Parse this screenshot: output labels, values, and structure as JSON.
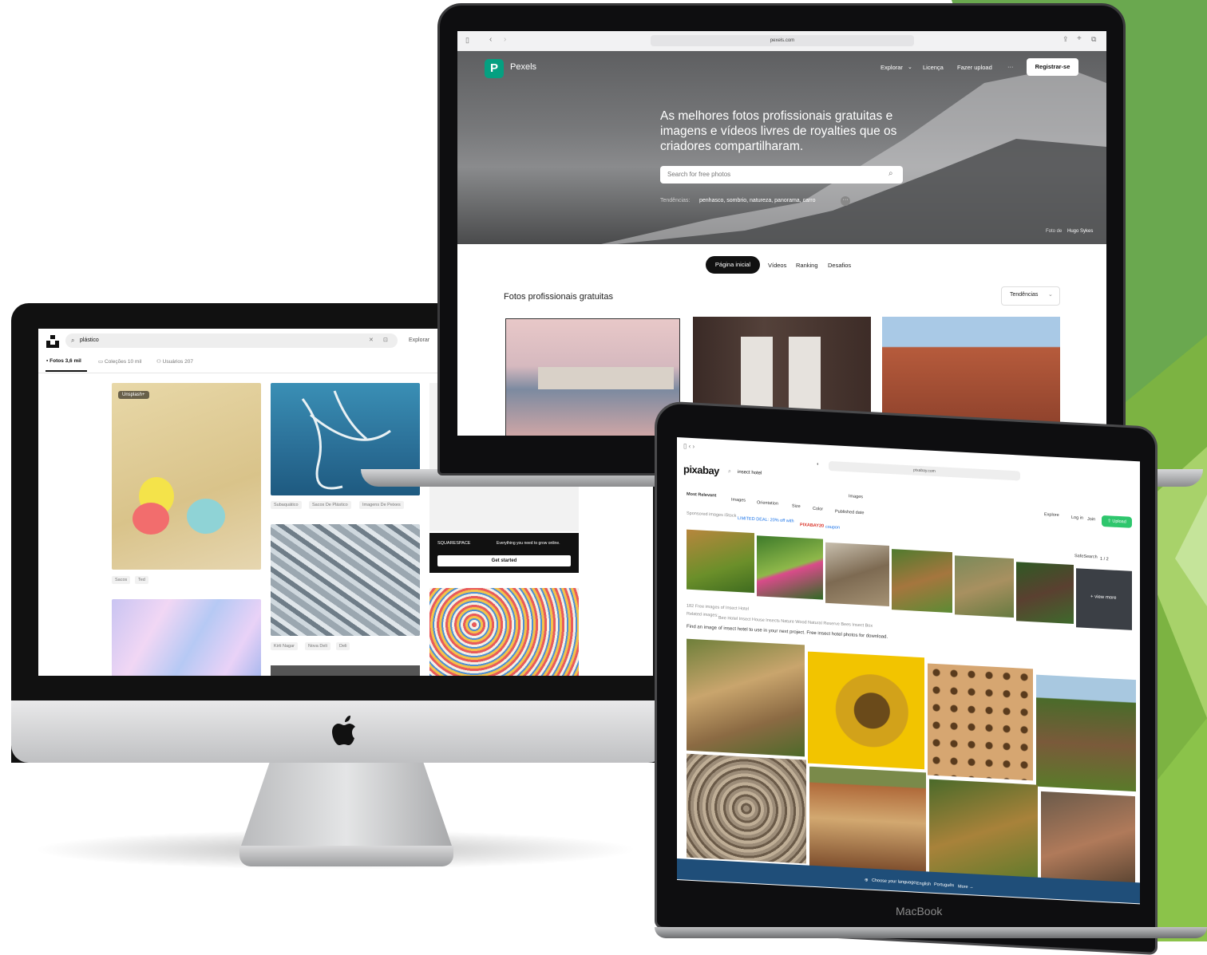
{
  "colors": {
    "green_accent": "#6aa84f",
    "green_light": "#8fc73e",
    "pexels_brand": "#05a081",
    "pixabay_green": "#2ec66d",
    "pixabay_footer": "#1f4e79"
  },
  "unsplash": {
    "search_value": "plástico",
    "explore": "Explorar",
    "tabs": [
      {
        "label": "Fotos 3,6 mil",
        "icon": "image-icon"
      },
      {
        "label": "Coleções 10 mil",
        "icon": "collection-icon"
      },
      {
        "label": "Usuários 207",
        "icon": "users-icon"
      }
    ],
    "badge": "Unsplash+",
    "tags_col1": [
      "Sacos",
      "Ted"
    ],
    "tags_col2a": [
      "Subaquático",
      "Sacos De Plástico",
      "Imagens De Peixes"
    ],
    "tags_col2b": [
      "Kirti Nagar",
      "Nova Deli",
      "Deli"
    ],
    "ad_brand": "SQUARESPACE",
    "ad_text": "Everything you need to grow online.",
    "ad_button": "Get started"
  },
  "pexels": {
    "url": "pexels.com",
    "brand": "Pexels",
    "nav": [
      "Explorar",
      "Licença",
      "Fazer upload",
      "···"
    ],
    "signup": "Registrar-se",
    "headline": "As melhores fotos profissionais gratuitas e imagens e vídeos livres de royalties que os criadores compartilharam.",
    "search_placeholder": "Search for free photos",
    "trends_label": "Tendências:",
    "trends": "penhasco, sombrio, natureza, panorama, carro",
    "photo_credit_prefix": "Foto de",
    "photo_credit_name": "Hugo Sykes",
    "tabs": [
      "Página inicial",
      "Vídeos",
      "Ranking",
      "Desafios"
    ],
    "section_title": "Fotos profissionais gratuitas",
    "sort_label": "Tendências"
  },
  "pixabay": {
    "brand": "pixabay",
    "url": "pixabay.com",
    "search_value": "insect hotel",
    "media_select": "Images",
    "filters": [
      "Most Relevant",
      "Images",
      "Orientation",
      "Size",
      "Color",
      "Published date"
    ],
    "nav": [
      "Explore",
      "Log in",
      "Join"
    ],
    "upload": "Upload",
    "sponsored": "Sponsored images iStock",
    "deal": "LIMITED DEAL: 20% off with",
    "coupon_code": "PIXABAY20",
    "coupon_word": "coupon",
    "safesearch": "SafeSearch",
    "pager": "1 / 2",
    "view_more": "+ view more",
    "results_line": "182 Free images of Insect Hotel",
    "related_label": "Related images:",
    "related": "Bee Hotel  Insect House  Insects  Nature  Wood  Natural Reserve  Bees  Insect Box",
    "description": "Find an image of insect hotel to use in your next project. Free insect hotel photos for download.",
    "footer_lang": "Choose your language:",
    "footer_langs": [
      "English",
      "Português",
      "More →"
    ],
    "device_label": "MacBook"
  }
}
